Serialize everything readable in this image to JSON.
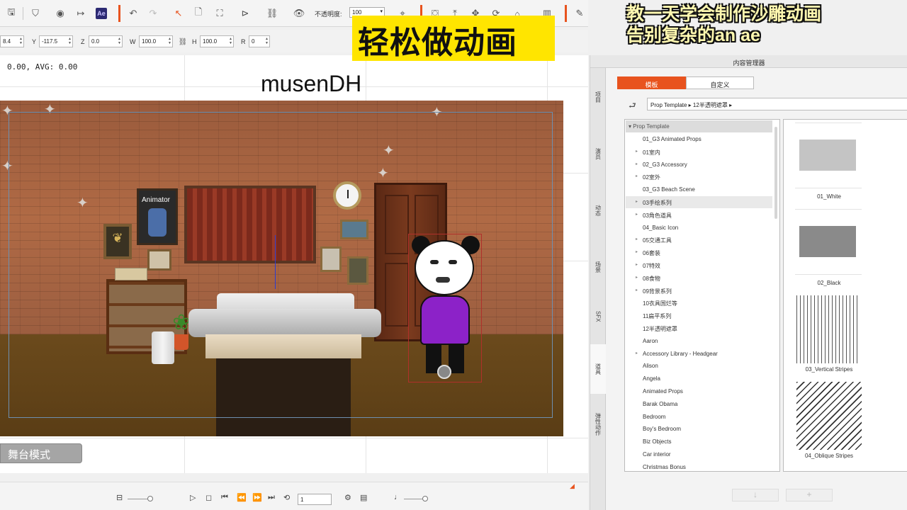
{
  "toolbar": {
    "opacity_label": "不透明度:",
    "opacity_value": "100",
    "ae_badge": "Ae"
  },
  "transform": {
    "x_value": "8.4",
    "y_label": "Y",
    "y_value": "-117.5",
    "z_label": "Z",
    "z_value": "0.0",
    "w_label": "W",
    "w_value": "100.0",
    "h_label": "H",
    "h_value": "100.0",
    "r_label": "R",
    "r_value": "0"
  },
  "stage": {
    "fps_text": "0.00, AVG: 0.00",
    "stage_mode_label": "舞台模式",
    "poster_text": "Animator"
  },
  "overlay": {
    "title_banner": "轻松做动画",
    "watermark": "musenDH",
    "caption_line1": "教一天学会制作沙雕动画",
    "caption_line2": "告别复杂的an ae"
  },
  "playback": {
    "frame_value": "1"
  },
  "panel": {
    "title": "内容管理器",
    "tabs": [
      {
        "label": "模板",
        "active": true
      },
      {
        "label": "自定义",
        "active": false
      }
    ],
    "side_tabs": [
      "项目",
      "演员",
      "动态",
      "场景",
      "SFX",
      "道具",
      "弹性动作"
    ],
    "path": [
      "Prop Template",
      "12半透明遮罩"
    ],
    "tree_root": "Prop Template",
    "tree_items": [
      {
        "label": "01_G3 Animated Props",
        "expandable": false
      },
      {
        "label": "01室内",
        "expandable": true
      },
      {
        "label": "02_G3 Accessory",
        "expandable": true
      },
      {
        "label": "02室外",
        "expandable": true
      },
      {
        "label": "03_G3 Beach Scene",
        "expandable": false
      },
      {
        "label": "03手绘系列",
        "expandable": true,
        "highlighted": true
      },
      {
        "label": "03角色道具",
        "expandable": true
      },
      {
        "label": "04_Basic Icon",
        "expandable": false
      },
      {
        "label": "05交通工具",
        "expandable": true
      },
      {
        "label": "06套装",
        "expandable": true
      },
      {
        "label": "07特效",
        "expandable": true
      },
      {
        "label": "08食物",
        "expandable": true
      },
      {
        "label": "09背景系列",
        "expandable": true
      },
      {
        "label": "10衣具国烂等",
        "expandable": false
      },
      {
        "label": "11扁平系列",
        "expandable": false
      },
      {
        "label": "12半透明遮罩",
        "expandable": false
      },
      {
        "label": "Aaron",
        "expandable": false
      },
      {
        "label": "Accessory Library - Headgear",
        "expandable": true
      },
      {
        "label": "Alison",
        "expandable": false
      },
      {
        "label": "Angela",
        "expandable": false
      },
      {
        "label": "Animated Props",
        "expandable": false
      },
      {
        "label": "Barak Obama",
        "expandable": false
      },
      {
        "label": "Bedroom",
        "expandable": false
      },
      {
        "label": "Boy's Bedroom",
        "expandable": false
      },
      {
        "label": "Biz Objects",
        "expandable": false
      },
      {
        "label": "Car interior",
        "expandable": false
      },
      {
        "label": "Christmas Bonus",
        "expandable": false
      }
    ],
    "thumbnails": [
      {
        "label": "01_White",
        "swatch": "#c4c4c4"
      },
      {
        "label": "02_Black",
        "swatch": "#8a8a8a"
      },
      {
        "label": "03_Vertical Stripes",
        "swatch": "vertical"
      },
      {
        "label": "04_Oblique Stripes",
        "swatch": "oblique"
      }
    ],
    "buttons": {
      "down": "↓",
      "add": "+"
    }
  },
  "colors": {
    "accent": "#e8531e",
    "banner": "#ffe500"
  }
}
